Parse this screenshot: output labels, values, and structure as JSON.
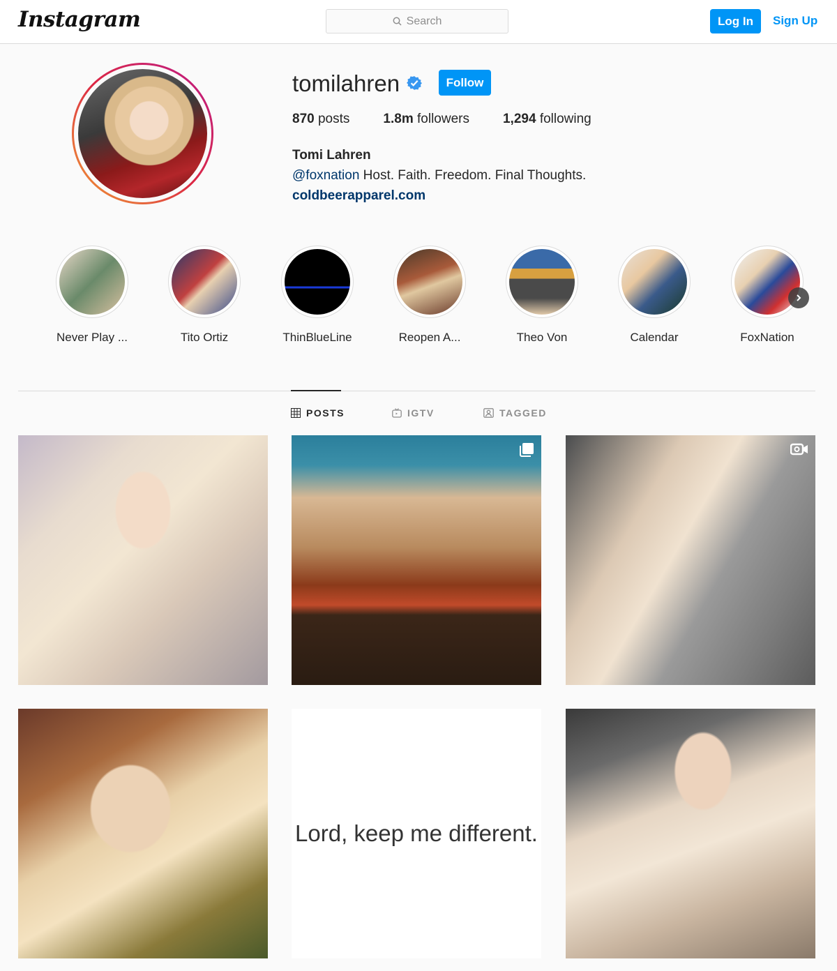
{
  "header": {
    "logo": "Instagram",
    "search_placeholder": "Search",
    "login_label": "Log In",
    "signup_label": "Sign Up"
  },
  "profile": {
    "username": "tomilahren",
    "verified": true,
    "follow_label": "Follow",
    "stats": [
      {
        "value": "870",
        "label": "posts"
      },
      {
        "value": "1.8m",
        "label": "followers"
      },
      {
        "value": "1,294",
        "label": "following"
      }
    ],
    "full_name": "Tomi Lahren",
    "bio_mention": "@foxnation",
    "bio_text": " Host. Faith. Freedom. Final Thoughts.",
    "website": "coldbeerapparel.com"
  },
  "highlights": [
    {
      "label": "Never Play ...",
      "color": "#7a9a7a"
    },
    {
      "label": "Tito Ortiz",
      "color": "#3a3a6a"
    },
    {
      "label": "ThinBlueLine",
      "color": "#000000"
    },
    {
      "label": "Reopen A...",
      "color": "#8a4a2a"
    },
    {
      "label": "Theo Von",
      "color": "#3a6aa8"
    },
    {
      "label": "Calendar",
      "color": "#5a6a8a"
    },
    {
      "label": "FoxNation",
      "color": "#2a4a9a"
    }
  ],
  "tabs": [
    {
      "label": "POSTS",
      "icon": "grid-icon",
      "active": true
    },
    {
      "label": "IGTV",
      "icon": "igtv-icon",
      "active": false
    },
    {
      "label": "TAGGED",
      "icon": "tagged-icon",
      "active": false
    }
  ],
  "posts": [
    {
      "type": "image"
    },
    {
      "type": "carousel"
    },
    {
      "type": "video"
    },
    {
      "type": "image"
    },
    {
      "type": "text",
      "text": "Lord, keep me different."
    },
    {
      "type": "image"
    }
  ],
  "colors": {
    "accent": "#0095f6",
    "link": "#00376b",
    "border": "#dbdbdb",
    "background": "#fafafa"
  }
}
